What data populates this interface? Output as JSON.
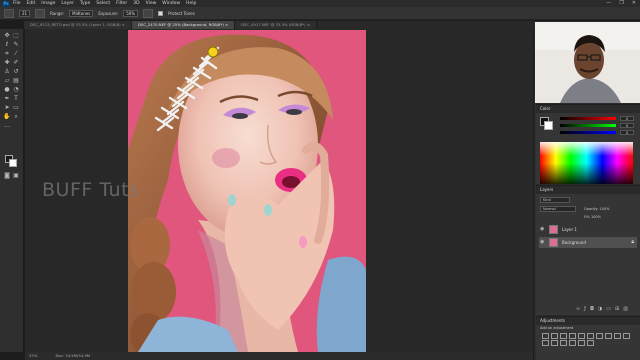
{
  "menubar": {
    "logo": "Ps",
    "items": [
      "File",
      "Edit",
      "Image",
      "Layer",
      "Type",
      "Select",
      "Filter",
      "3D",
      "View",
      "Window",
      "Help"
    ],
    "window_controls": [
      "—",
      "❐",
      "✕"
    ]
  },
  "options_bar": {
    "size_value": "21",
    "mode_label": "Range:",
    "mode_value": "Midtones",
    "exposure_label": "Exposure:",
    "exposure_value": "50%",
    "protect_tones_label": "Protect Tones"
  },
  "tabs": [
    {
      "label": "DSC_9213_RETO.psd @ 33.3% (Layer 1, RGB/8) ×",
      "active": false
    },
    {
      "label": "DSC_2470.NEF @ 25% (Background, RGB/8*) ×",
      "active": true
    },
    {
      "label": "DSC_4917.NEF @ 33.3% (RGB/8*) ×",
      "active": false
    }
  ],
  "canvas": {
    "watermark": "BUFF Tuts"
  },
  "statusbar": {
    "zoom": "33%",
    "doc": "Doc: 34.9M/34.9M"
  },
  "color_panel": {
    "title": "Color",
    "values": [
      "0",
      "0",
      "0"
    ]
  },
  "layers_panel": {
    "title": "Layers",
    "kind": "Kind",
    "blend": "Normal",
    "opacity": "Opacity: 100%",
    "fill": "Fill: 100%",
    "layers": [
      {
        "name": "Layer 1",
        "selected": false
      },
      {
        "name": "Background",
        "selected": true
      }
    ]
  },
  "adjustments_panel": {
    "title": "Adjustments",
    "subtitle": "Add an adjustment"
  },
  "colors": {
    "photo_bg": "#e0567c",
    "app_dark": "#282828",
    "accent_yellow": "#f2d21f"
  }
}
